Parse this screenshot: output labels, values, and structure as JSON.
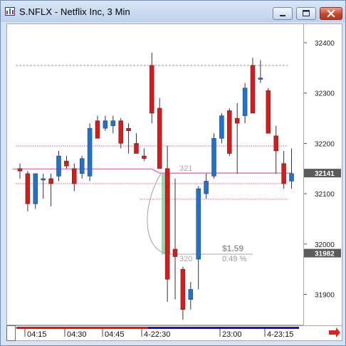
{
  "window": {
    "title": "S.NFLX - Netflix Inc, 3 Min",
    "icon": "chart-window-icon",
    "buttons": [
      "minimize-icon",
      "maximize-icon",
      "close-icon"
    ]
  },
  "price_axis": {
    "ticks": [
      {
        "value": 32400,
        "label": "32400"
      },
      {
        "value": 32300,
        "label": "32300"
      },
      {
        "value": 32200,
        "label": "32200"
      },
      {
        "value": 32100,
        "label": "32100"
      },
      {
        "value": 32000,
        "label": "32000"
      },
      {
        "value": 31900,
        "label": "31900"
      }
    ],
    "current_price_tag": {
      "value": 32141,
      "label": "32141"
    },
    "low_price_tag": {
      "value": 31982,
      "label": "31982"
    }
  },
  "time_axis": {
    "labels": [
      "04:15",
      "04:30",
      "04:45",
      "4-22:30",
      "23:00",
      "4-23:15"
    ]
  },
  "annotations": {
    "level_upper": "321",
    "level_lower": "320",
    "move_dollars": "$1.59",
    "move_percent": "0.49 %"
  },
  "colors": {
    "up_candle": "#1e73d2",
    "down_candle": "#d81a1a",
    "pink_lines": "#e27fc8",
    "gray_line": "#9a9a9a",
    "highlight": "#93d2a5",
    "arrow": "#e02020",
    "time_bar_red": "#d81a1a",
    "time_bar_blue": "#1a1aa8"
  },
  "chart_data": {
    "type": "candlestick",
    "title": "S.NFLX - Netflix Inc, 3 Min",
    "ylim": [
      31840,
      32440
    ],
    "candles": [
      {
        "o": 32150,
        "h": 32160,
        "l": 32130,
        "c": 32145
      },
      {
        "o": 32140,
        "h": 32145,
        "l": 32065,
        "c": 32080
      },
      {
        "o": 32080,
        "h": 32140,
        "l": 32070,
        "c": 32140
      },
      {
        "o": 32130,
        "h": 32140,
        "l": 32090,
        "c": 32130
      },
      {
        "o": 32130,
        "h": 32140,
        "l": 32075,
        "c": 32120
      },
      {
        "o": 32135,
        "h": 32185,
        "l": 32125,
        "c": 32175
      },
      {
        "o": 32165,
        "h": 32175,
        "l": 32150,
        "c": 32155
      },
      {
        "o": 32150,
        "h": 32160,
        "l": 32105,
        "c": 32120
      },
      {
        "o": 32140,
        "h": 32175,
        "l": 32130,
        "c": 32170
      },
      {
        "o": 32135,
        "h": 32240,
        "l": 32125,
        "c": 32230
      },
      {
        "o": 32245,
        "h": 32255,
        "l": 32210,
        "c": 32210
      },
      {
        "o": 32230,
        "h": 32255,
        "l": 32225,
        "c": 32245
      },
      {
        "o": 32235,
        "h": 32255,
        "l": 32220,
        "c": 32245
      },
      {
        "o": 32245,
        "h": 32250,
        "l": 32190,
        "c": 32200
      },
      {
        "o": 32230,
        "h": 32240,
        "l": 32180,
        "c": 32225
      },
      {
        "o": 32200,
        "h": 32220,
        "l": 32180,
        "c": 32180
      },
      {
        "o": 32175,
        "h": 32190,
        "l": 32165,
        "c": 32170
      },
      {
        "o": 32355,
        "h": 32380,
        "l": 32240,
        "c": 32260
      },
      {
        "o": 32270,
        "h": 32290,
        "l": 32150,
        "c": 32150
      },
      {
        "o": 32150,
        "h": 32195,
        "l": 31885,
        "c": 31930
      },
      {
        "o": 31990,
        "h": 32130,
        "l": 31890,
        "c": 31975
      },
      {
        "o": 31950,
        "h": 31955,
        "l": 31850,
        "c": 31870
      },
      {
        "o": 31890,
        "h": 31925,
        "l": 31870,
        "c": 31910
      },
      {
        "o": 31970,
        "h": 32115,
        "l": 31910,
        "c": 32110
      },
      {
        "o": 32100,
        "h": 32140,
        "l": 32090,
        "c": 32125
      },
      {
        "o": 32135,
        "h": 32220,
        "l": 32130,
        "c": 32210
      },
      {
        "o": 32210,
        "h": 32260,
        "l": 32200,
        "c": 32255
      },
      {
        "o": 32265,
        "h": 32270,
        "l": 32175,
        "c": 32180
      },
      {
        "o": 32250,
        "h": 32280,
        "l": 32140,
        "c": 32240
      },
      {
        "o": 32255,
        "h": 32320,
        "l": 32240,
        "c": 32310
      },
      {
        "o": 32355,
        "h": 32370,
        "l": 32260,
        "c": 32260
      },
      {
        "o": 32330,
        "h": 32365,
        "l": 32320,
        "c": 32330
      },
      {
        "o": 32305,
        "h": 32310,
        "l": 32220,
        "c": 32220
      },
      {
        "o": 32215,
        "h": 32235,
        "l": 32140,
        "c": 32185
      },
      {
        "o": 32160,
        "h": 32185,
        "l": 32110,
        "c": 32120
      },
      {
        "o": 32125,
        "h": 32190,
        "l": 32110,
        "c": 32140
      }
    ],
    "moving_average": [
      32149,
      32149,
      32149,
      32149,
      32149,
      32149,
      32149,
      32149,
      32149,
      32149,
      32149,
      32149,
      32149,
      32149,
      32149,
      32149,
      32149,
      32149,
      32141,
      32141,
      32141,
      32141,
      32141,
      32141,
      32141,
      32141,
      32141,
      32141,
      32141,
      32141,
      32141,
      32141,
      32141,
      32141,
      32141,
      32141
    ],
    "horizontal_levels": [
      {
        "value": 32355,
        "style": "dashed-gray"
      },
      {
        "value": 32195,
        "style": "pink"
      },
      {
        "value": 32120,
        "style": "pink"
      },
      {
        "value": 32089,
        "style": "pink"
      }
    ],
    "highlight": {
      "from_value": 32140,
      "to_value": 31980
    }
  }
}
